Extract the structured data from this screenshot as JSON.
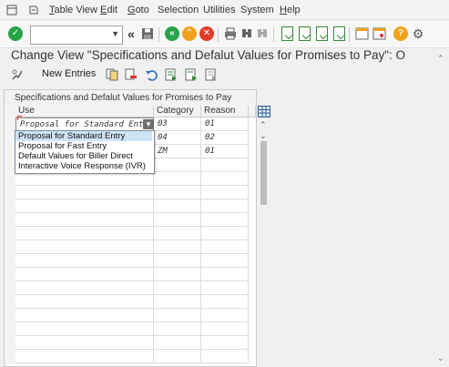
{
  "menubar": {
    "items": [
      {
        "underline": "T",
        "rest": "able View"
      },
      {
        "underline": "E",
        "rest": "dit"
      },
      {
        "underline": "G",
        "rest": "oto"
      },
      {
        "underline": "",
        "rest": "Selection"
      },
      {
        "underline": "",
        "rest": "Utilities"
      },
      {
        "underline": "",
        "rest": "System"
      },
      {
        "underline": "H",
        "rest": "elp"
      }
    ]
  },
  "toolbar": {
    "command_value": "",
    "icons": [
      "enter-icon",
      "command-field",
      "back-arrows-icon",
      "save-icon",
      "back-icon",
      "exit-icon",
      "cancel-icon",
      "print-icon",
      "find-icon",
      "find-next-icon",
      "first-page-icon",
      "previous-page-icon",
      "next-page-icon",
      "last-page-icon",
      "create-session-icon",
      "shortcut-icon",
      "help-icon",
      "customize-layout-icon"
    ]
  },
  "title": "Change View \"Specifications and Defalut Values for Promises to Pay\": O",
  "app_toolbar": {
    "new_entries_label": "New Entries"
  },
  "table": {
    "caption": "Specifications and Defalut Values for Promises to Pay",
    "columns": [
      "Use",
      "Category",
      "Reason"
    ],
    "rows": [
      {
        "use": "Proposal for Standard Entry",
        "category": "03",
        "reason": "01"
      },
      {
        "use": "",
        "category": "04",
        "reason": "02"
      },
      {
        "use": "",
        "category": "ZM",
        "reason": "01"
      }
    ]
  },
  "dropdown": {
    "options": [
      "Proposal for Standard Entry",
      "Proposal for Fast Entry",
      "Default Values for Biller Direct",
      "Interactive Voice Response (IVR)"
    ],
    "selected_index": 0
  },
  "colors": {
    "enter_green": "#26a347",
    "cancel_red": "#e23a2a",
    "exit_orange": "#f2a21a",
    "help_orange": "#f2a21a",
    "selected_option": "#cfe3f6"
  }
}
